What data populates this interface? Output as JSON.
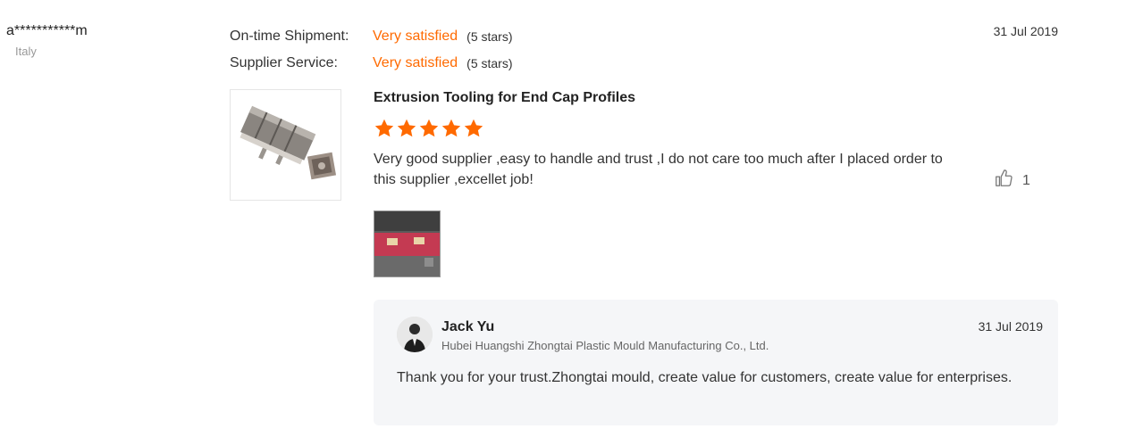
{
  "reviewer": {
    "name": "a***********m",
    "country": "Italy"
  },
  "ratings": [
    {
      "label": "On-time Shipment:",
      "value": "Very satisfied",
      "stars_text": "(5 stars)"
    },
    {
      "label": "Supplier Service:",
      "value": "Very satisfied",
      "stars_text": "(5 stars)"
    }
  ],
  "review": {
    "date": "31 Jul 2019",
    "product_title": "Extrusion Tooling for End Cap Profiles",
    "star_rating": 5,
    "text": "Very good supplier ,easy to handle and trust ,I do not care too much after I placed order to this supplier ,excellet job!",
    "likes": "1"
  },
  "reply": {
    "name": "Jack Yu",
    "company": "Hubei Huangshi Zhongtai Plastic Mould Manufacturing Co., Ltd.",
    "date": "31 Jul 2019",
    "text": "Thank you for your trust.Zhongtai mould, create value for customers, create value for enterprises."
  },
  "colors": {
    "accent": "#ff6a00",
    "reply_bg": "#f5f6f8"
  },
  "icons": {
    "like": "thumbs-up-icon",
    "star": "star-icon"
  }
}
